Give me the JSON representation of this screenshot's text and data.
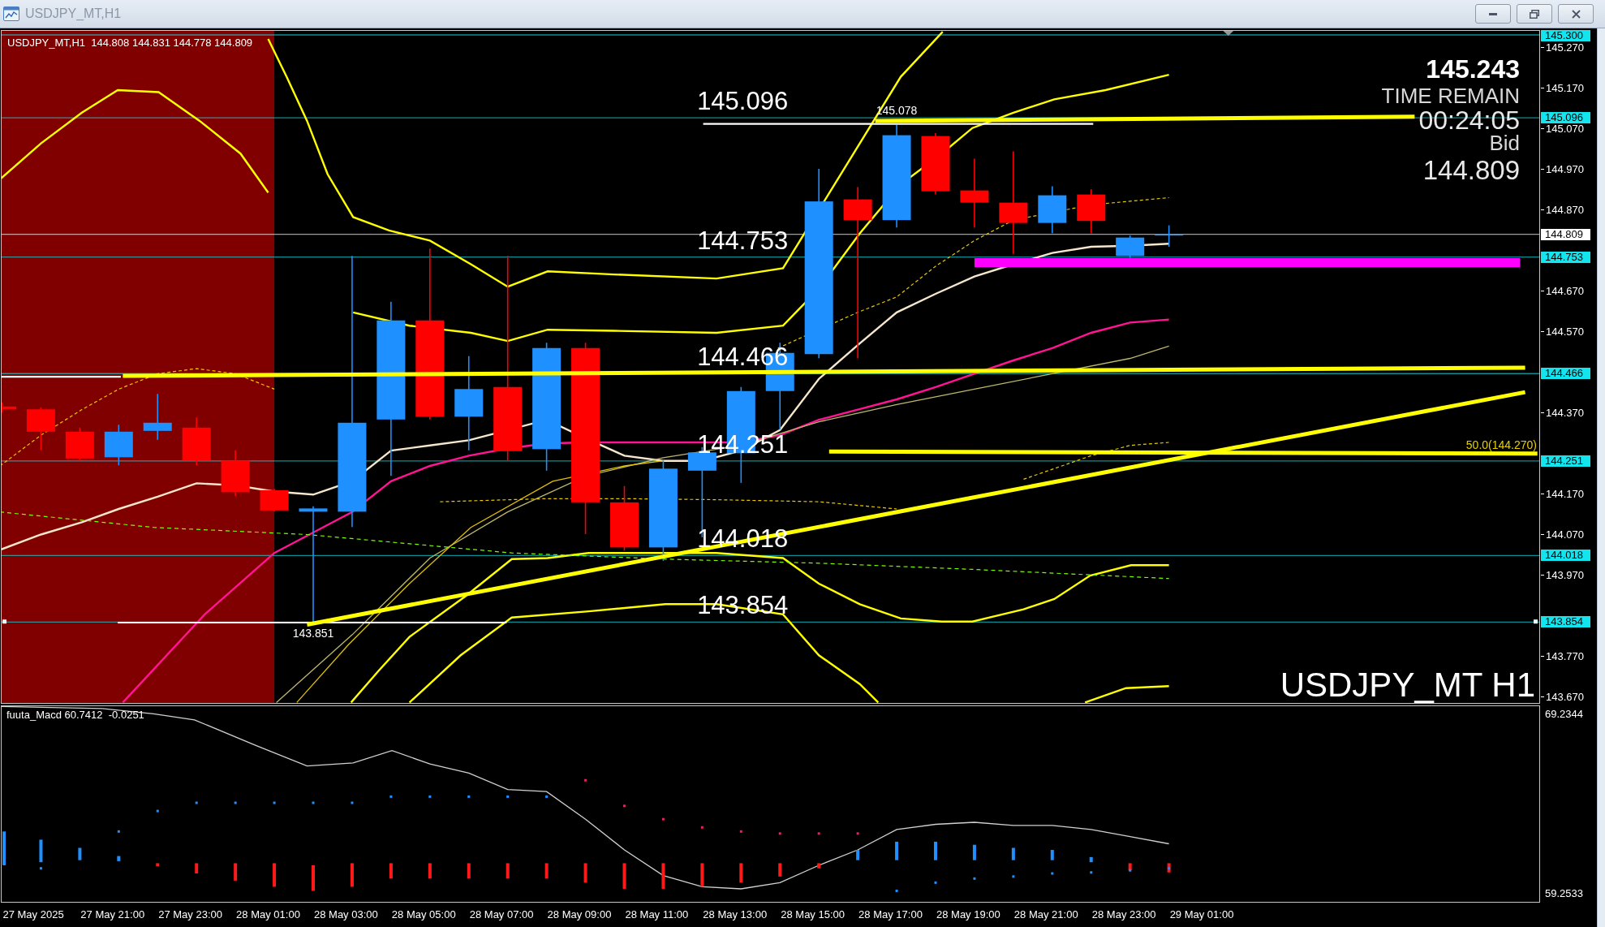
{
  "window": {
    "title": "USDJPY_MT,H1"
  },
  "chart": {
    "header": "USDJPY_MT,H1  144.808 144.831 144.778 144.809",
    "info": {
      "price": "145.243",
      "timer_label": "TIME REMAIN",
      "timer": "00:24:05",
      "bid_label": "Bid",
      "bid": "144.809"
    },
    "level_labels": [
      "145.096",
      "144.753",
      "144.466",
      "144.251",
      "144.018",
      "143.854"
    ],
    "high_label": "145.078",
    "low_label": "143.851",
    "fib_label": "50.0(144.270)",
    "symbol_label": "USDJPY_MT H1",
    "price_axis": {
      "labels": [
        "145.270",
        "145.170",
        "145.070",
        "144.970",
        "144.870",
        "144.670",
        "144.570",
        "144.370",
        "144.170",
        "144.070",
        "143.970",
        "143.770",
        "143.670"
      ],
      "tags": [
        {
          "label": "145.300",
          "color": "#14e4ee"
        },
        {
          "label": "145.096",
          "color": "#14e4ee"
        },
        {
          "label": "144.809",
          "color": "#ffffff"
        },
        {
          "label": "144.753",
          "color": "#14e4ee"
        },
        {
          "label": "144.466",
          "color": "#14e4ee"
        },
        {
          "label": "144.251",
          "color": "#14e4ee"
        },
        {
          "label": "144.018",
          "color": "#14e4ee"
        },
        {
          "label": "143.854",
          "color": "#14e4ee"
        }
      ]
    }
  },
  "oscillator": {
    "header": "fuuta_Macd 60.7412  -0.0251",
    "scale_max": "69.2344",
    "scale_min": "59.2533"
  },
  "time_axis": {
    "labels": [
      "27 May 2025",
      "27 May 21:00",
      "27 May 23:00",
      "28 May 01:00",
      "28 May 03:00",
      "28 May 05:00",
      "28 May 07:00",
      "28 May 09:00",
      "28 May 11:00",
      "28 May 13:00",
      "28 May 15:00",
      "28 May 17:00",
      "28 May 19:00",
      "28 May 21:00",
      "28 May 23:00",
      "29 May 01:00"
    ]
  }
}
